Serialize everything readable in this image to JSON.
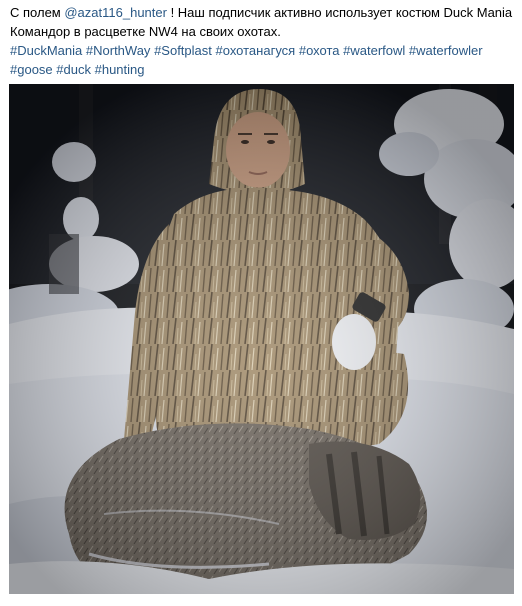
{
  "post": {
    "line1": {
      "prefix": "С полем ",
      "mention": "@azat116_hunter",
      "suffix": " ! Наш подписчик активно использует костюм Duck Mania"
    },
    "line2": "Командор в расцветке NW4 на своих охотах.",
    "hashtags_row1": [
      "#DuckMania",
      "#NorthWay",
      "#Softplast",
      "#охотанагуся",
      "#охота",
      "#waterfowl",
      "#waterfowler"
    ],
    "hashtags_row2": [
      "#goose",
      "#duck",
      "#hunting"
    ]
  },
  "photo": {
    "subject": "hunter in camouflage suit with wild boar in snow",
    "colors": {
      "night_sky": "#0b0d12",
      "snow": "#e9ecf3",
      "snow_shadow": "#b9bfcc",
      "camo_base": "#9a8465",
      "camo_dark": "#5a4a35",
      "boar_fur": "#6e655c"
    }
  }
}
